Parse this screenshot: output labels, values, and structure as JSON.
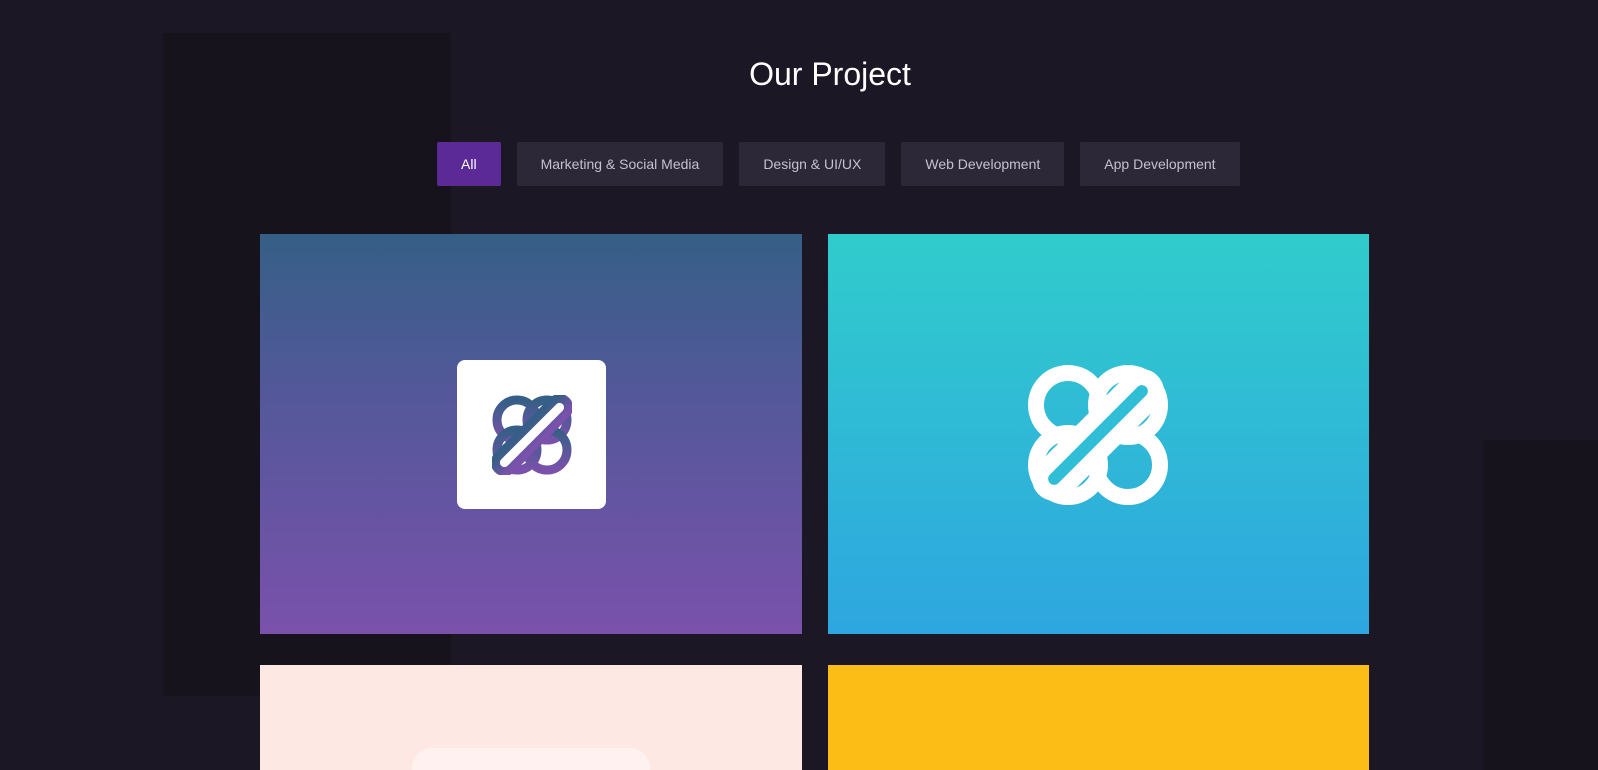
{
  "section": {
    "title": "Our Project"
  },
  "filters": [
    {
      "label": "All",
      "active": true
    },
    {
      "label": "Marketing & Social Media",
      "active": false
    },
    {
      "label": "Design & UI/UX",
      "active": false
    },
    {
      "label": "Web Development",
      "active": false
    },
    {
      "label": "App Development",
      "active": false
    }
  ],
  "colors": {
    "background": "#1c1724",
    "accent": "#5c2a96",
    "filter_inactive": "#2c2838"
  },
  "projects": [
    {
      "icon": "brand-logo-icon",
      "background": "blue-purple-gradient"
    },
    {
      "icon": "brand-logo-icon",
      "background": "cyan-blue-gradient"
    },
    {
      "icon": "",
      "background": "#fde8e4"
    },
    {
      "icon": "",
      "background": "#fbbd16"
    }
  ]
}
